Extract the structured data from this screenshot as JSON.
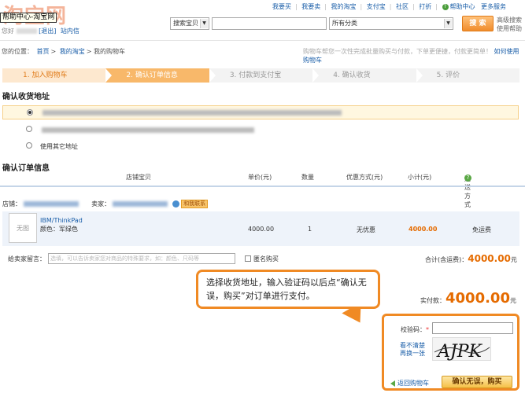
{
  "header": {
    "logo_text": "淘宝网",
    "tooltip": "帮助中心-淘宝网",
    "greeting": "您好",
    "logout": "[退出]",
    "messages": "站内信",
    "nav": [
      "我要买",
      "我要卖",
      "我的淘宝",
      "支付宝",
      "社区",
      "打折"
    ],
    "help": "帮助中心",
    "more": "更多服务"
  },
  "search": {
    "scope": "搜索宝贝",
    "category": "所有分类",
    "button": "搜 索",
    "advanced": "高级搜索",
    "usage": "使用帮助"
  },
  "breadcrumb": {
    "prefix": "您的位置：",
    "items": [
      "首页",
      "我的淘宝",
      "我的购物车"
    ]
  },
  "cart_tip": {
    "text": "购物车帮您一次性完成批量购买与付款，下单更便捷，付款更简单！",
    "link": "如何使用购物车"
  },
  "steps": [
    "1. 加入购物车",
    "2. 确认订单信息",
    "3. 付款到支付宝",
    "4. 确认收货",
    "5. 评价"
  ],
  "address": {
    "title": "确认收货地址",
    "other": "使用其它地址"
  },
  "order": {
    "title": "确认订单信息",
    "columns": {
      "shop_item": "店铺宝贝",
      "unit_price": "单价(元)",
      "qty": "数量",
      "discount": "优惠方式(元)",
      "subtotal": "小计(元)",
      "shipping": "运送方式"
    },
    "shop_label": "店铺：",
    "seller_label": "卖家：",
    "contact": "和我联系",
    "item": {
      "image": "无图",
      "name": "IBM/ThinkPad",
      "color": "颜色：军绿色",
      "price": "4000.00",
      "qty": "1",
      "discount": "无优惠",
      "subtotal": "4000.00",
      "shipping": "免运费"
    },
    "note_label": "给卖家留言：",
    "note_placeholder": "选填，可以告诉卖家您对商品的特殊要求，如：颜色、尺码等",
    "anonymous": "匿名购买",
    "total_label": "合计(含运费)：",
    "total": "4000.00",
    "total_unit": "元",
    "paid_label": "实付款：",
    "paid": "4000.00",
    "paid_unit": "元"
  },
  "callout": "选择收货地址，输入验证码以后点“确认无误，购买”对订单进行支付。",
  "captcha": {
    "label": "校验码：",
    "required": "*",
    "refresh": "看不清楚\n再换一张",
    "image_text": "AJPK",
    "back": "返回购物车",
    "confirm": "确认无误，购买"
  }
}
